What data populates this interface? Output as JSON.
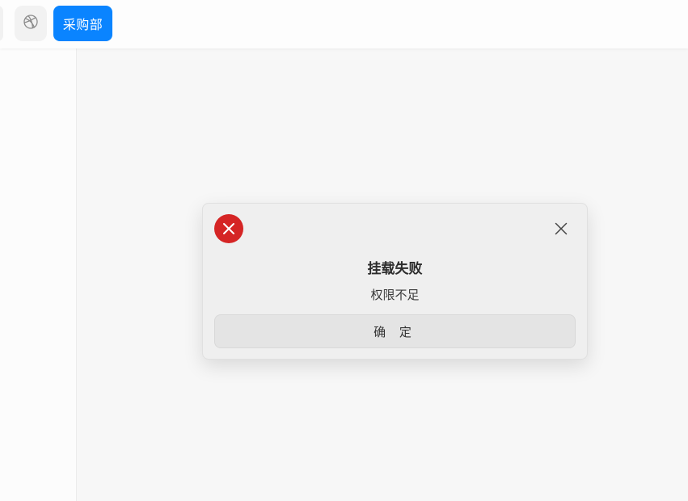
{
  "topbar": {
    "icon_button": {
      "icon": "dribbble-icon"
    },
    "department_button": {
      "label": "采购部",
      "color": "#0a84ff"
    }
  },
  "dialog": {
    "icon": "error-icon",
    "icon_color": "#d52525",
    "title": "挂载失败",
    "message": "权限不足",
    "confirm_label": "确 定",
    "close_icon": "close-icon"
  }
}
